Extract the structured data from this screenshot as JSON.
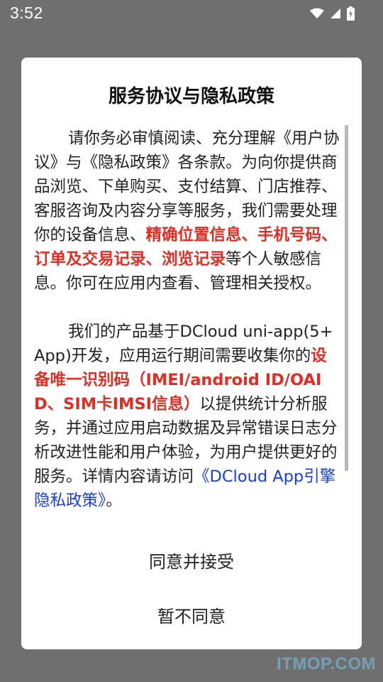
{
  "status_bar": {
    "time": "3:52",
    "icons": [
      "wifi-icon",
      "cellular-signal-icon",
      "battery-charging-icon"
    ]
  },
  "dialog": {
    "title": "服务协议与隐私政策",
    "paragraph1": {
      "part1": "请你务必审慎阅读、充分理解《用户协议》与《隐私政策》各条款。为向你提供商品浏览、下单购买、支付结算、门店推荐、客服咨询及内容分享等服务，我们需要处理你的设备信息、",
      "highlight": "精确位置信息、手机号码、订单及交易记录、浏览记录",
      "part2": "等个人敏感信息。你可在应用内查看、管理相关授权。"
    },
    "paragraph2": {
      "part1": "我们的产品基于DCloud uni-app(5+ App)开发，应用运行期间需要收集你的",
      "highlight": "设备唯一识别码（IMEI/android ID/OAID、SIM卡IMSI信息）",
      "part2": "以提供统计分析服务，并通过应用启动数据及异常错误日志分析改进性能和用户体验，为用户提供更好的服务。详情内容请访问",
      "link": "《DCloud App引擎隐私政策》",
      "end": "。"
    },
    "accept_label": "同意并接受",
    "decline_label": "暂不同意"
  },
  "colors": {
    "overlay": "#6f6f6f",
    "highlight": "#e02e24",
    "link": "#1a3ed6"
  },
  "watermark": "ITMOP.COM"
}
